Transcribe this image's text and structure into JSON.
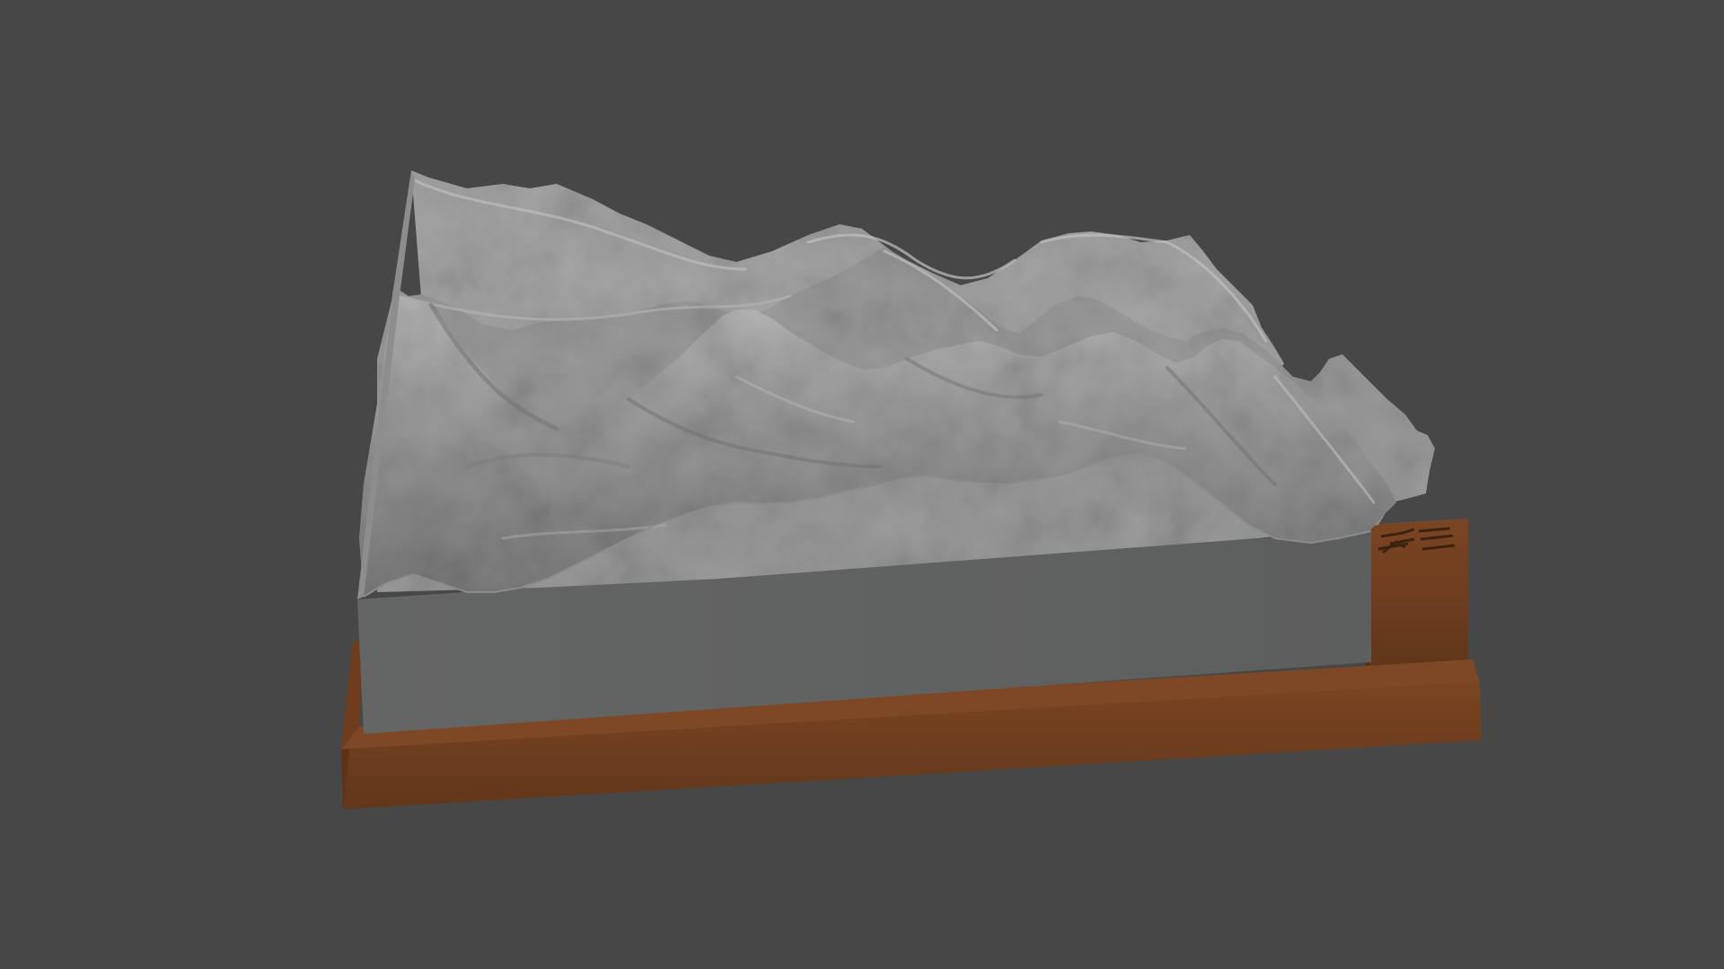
{
  "scene": {
    "subject": "terrain-relief-model",
    "colors": {
      "background": "#474747",
      "terrain_light": "#a9a9a9",
      "terrain_mid": "#8a8a8a",
      "terrain_dark": "#6f6f6f",
      "block_side": "#606161",
      "base_front": "#6b3c1c",
      "base_top": "#7b4624",
      "base_shadow": "#5a3116",
      "emblem": "#3e2210"
    }
  }
}
